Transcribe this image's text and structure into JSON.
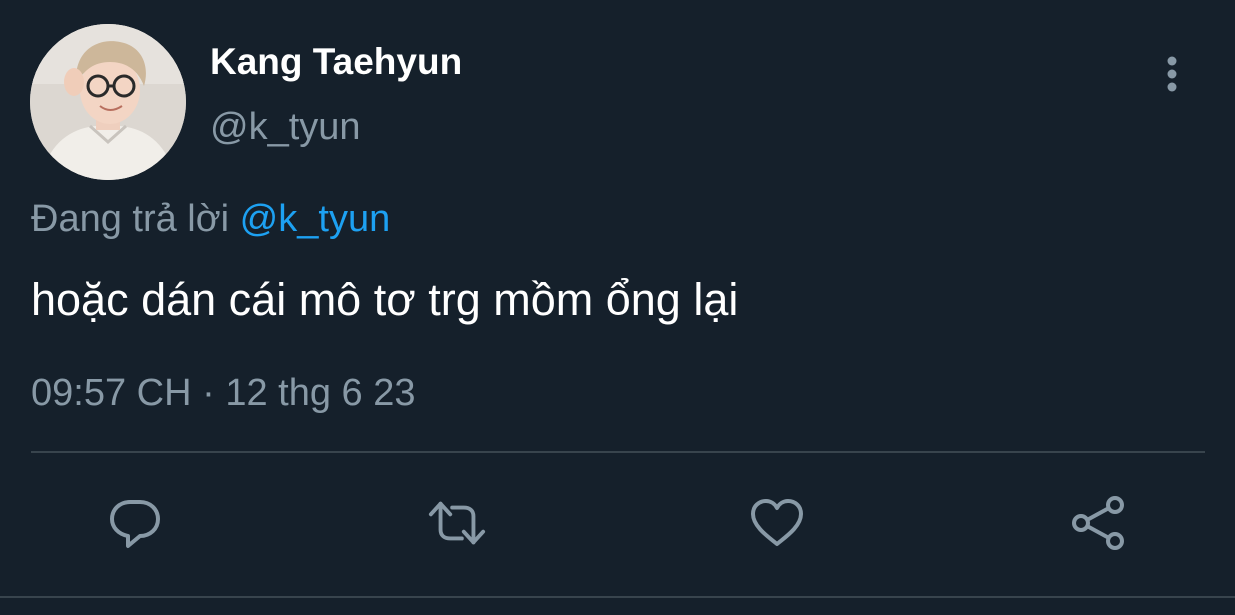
{
  "author": {
    "display_name": "Kang Taehyun",
    "handle": "@k_tyun"
  },
  "reply": {
    "prefix": "Đang trả lời",
    "mention": "@k_tyun"
  },
  "tweet": {
    "text": "hoặc dán cái mô tơ trg mồm ổng lại",
    "time": "09:57 CH",
    "separator": "·",
    "date": "12 thg 6 23"
  },
  "icons": {
    "more": "more-vertical-icon",
    "reply": "reply-icon",
    "retweet": "retweet-icon",
    "like": "heart-icon",
    "share": "share-icon"
  },
  "colors": {
    "background": "#15202b",
    "secondary_text": "#8899a6",
    "link": "#1da1f2",
    "divider": "#38444d"
  }
}
